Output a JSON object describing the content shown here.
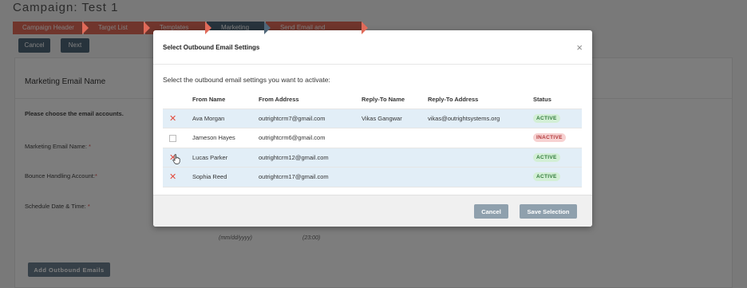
{
  "page": {
    "title": "Campaign: Test 1",
    "steps": [
      {
        "label": "Campaign Header",
        "state": "done"
      },
      {
        "label": "Target List",
        "state": "done"
      },
      {
        "label": "Templates",
        "state": "done"
      },
      {
        "label": "Marketing",
        "state": "current"
      },
      {
        "label": "Send Email and Summary",
        "state": "done"
      }
    ],
    "cancel_label": "Cancel",
    "next_label": "Next",
    "section_title": "Marketing Email Name",
    "choose_accounts": "Please choose the email accounts.",
    "marketing_email_name_label": "Marketing Email Name:",
    "bounce_label": "Bounce Handling Account:",
    "schedule_label": "Schedule Date & Time:",
    "required_mark": "*",
    "date_hint": "(mm/dd/yyyy)",
    "time_hint": "(23:00)",
    "add_outbound_label": "Add Outbound Emails"
  },
  "modal": {
    "title": "Select Outbound Email Settings",
    "close_glyph": "×",
    "intro": "Select the outbound email settings you want to activate:",
    "columns": [
      "",
      "From Name",
      "From Address",
      "Reply-To Name",
      "Reply-To Address",
      "Status"
    ],
    "rows": [
      {
        "selected": true,
        "from_name": "Ava Morgan",
        "from_address": "outrightcrm7@gmail.com",
        "reply_to_name": "Vikas Gangwar",
        "reply_to_address": "vikas@outrightsystems.org",
        "status": "ACTIVE"
      },
      {
        "selected": false,
        "from_name": "Jameson Hayes",
        "from_address": "outrightcrm6@gmail.com",
        "reply_to_name": "",
        "reply_to_address": "",
        "status": "INACTIVE"
      },
      {
        "selected": true,
        "from_name": "Lucas Parker",
        "from_address": "outrightcrm12@gmail.com",
        "reply_to_name": "",
        "reply_to_address": "",
        "status": "ACTIVE"
      },
      {
        "selected": true,
        "from_name": "Sophia Reed",
        "from_address": "outrightcrm17@gmail.com",
        "reply_to_name": "",
        "reply_to_address": "",
        "status": "ACTIVE"
      }
    ],
    "cancel_label": "Cancel",
    "save_label": "Save Selection"
  },
  "colors": {
    "step_done": "#e06a59",
    "step_current": "#4f6678",
    "selected_row": "#e2eef7",
    "remove_mark": "#e34a3c"
  },
  "icons": {
    "remove": "x-mark-icon",
    "close": "close-icon",
    "cursor": "hand-pointer-icon"
  }
}
